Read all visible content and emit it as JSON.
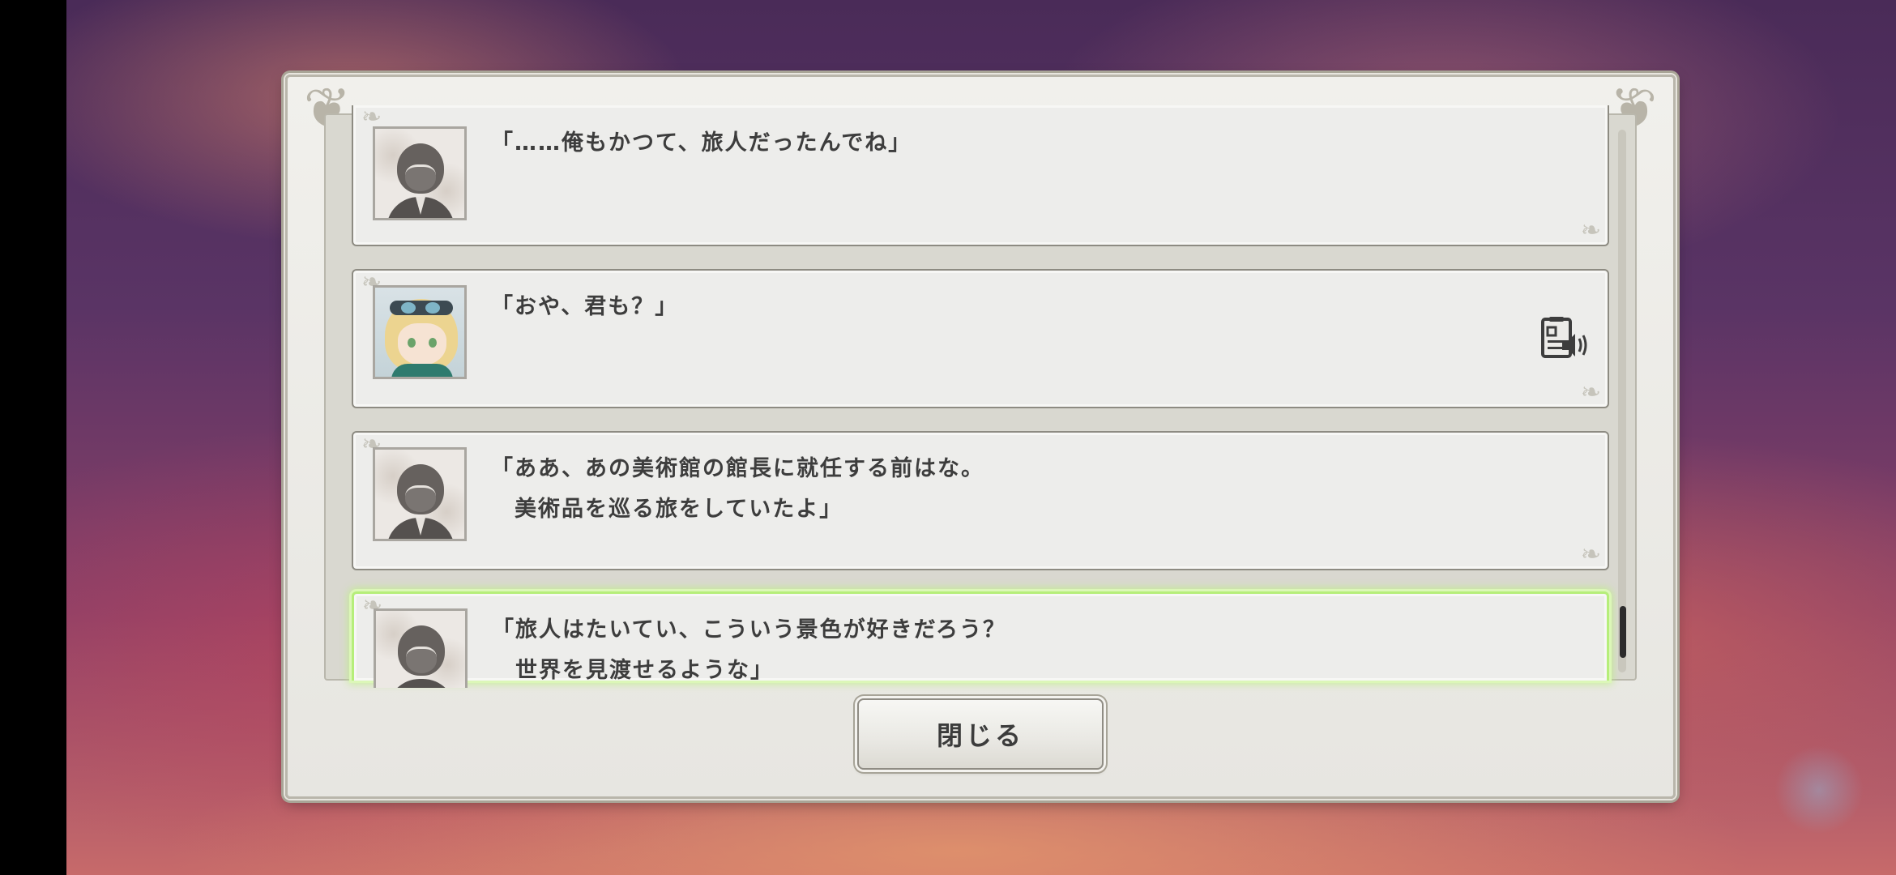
{
  "dialog": {
    "close_label": "閉じる"
  },
  "log": {
    "entries": [
      {
        "speaker": "silhouette",
        "lines": [
          "「……俺もかつて、旅人だったんでね」"
        ],
        "voice": false
      },
      {
        "speaker": "character",
        "lines": [
          "「おや、君も？」"
        ],
        "voice": true
      },
      {
        "speaker": "silhouette",
        "lines": [
          "「ああ、あの美術館の館長に就任する前はな。",
          "　美術品を巡る旅をしていたよ」"
        ],
        "voice": false
      },
      {
        "speaker": "silhouette",
        "lines": [
          "「旅人はたいてい、こういう景色が好きだろう？",
          "　世界を見渡せるような」"
        ],
        "voice": false,
        "highlighted": true
      }
    ]
  },
  "icons": {
    "voice": "voice-replay-icon",
    "speaker_unknown": "silhouette-avatar-icon",
    "speaker_character": "character-portrait"
  },
  "colors": {
    "highlight": "#b6ee7a",
    "panel": "#ededeb",
    "text": "#3d3d3d"
  }
}
